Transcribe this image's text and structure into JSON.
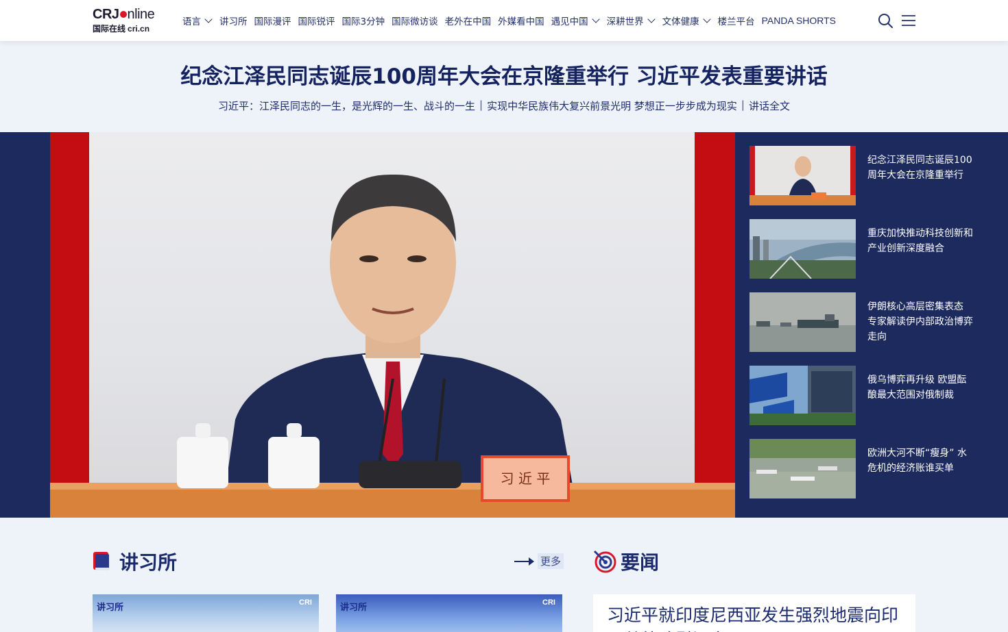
{
  "header": {
    "logo_brand": "CRJ",
    "logo_online": "nline",
    "logo_chinese": "国际在线",
    "logo_domain": "cri.cn",
    "nav": [
      {
        "label": "语言",
        "dropdown": true
      },
      {
        "label": "讲习所",
        "dropdown": false
      },
      {
        "label": "国际漫评",
        "dropdown": false
      },
      {
        "label": "国际锐评",
        "dropdown": false
      },
      {
        "label": "国际3分钟",
        "dropdown": false
      },
      {
        "label": "国际微访谈",
        "dropdown": false
      },
      {
        "label": "老外在中国",
        "dropdown": false
      },
      {
        "label": "外媒看中国",
        "dropdown": false
      },
      {
        "label": "遇见中国",
        "dropdown": true
      },
      {
        "label": "深耕世界",
        "dropdown": true
      },
      {
        "label": "文体健康",
        "dropdown": true
      },
      {
        "label": "楼兰平台",
        "dropdown": false
      },
      {
        "label": "PANDA SHORTS",
        "dropdown": false
      }
    ],
    "icons": {
      "search": "search-icon",
      "menu": "menu-icon"
    }
  },
  "headline": {
    "title": "纪念江泽民同志诞辰100周年大会在京隆重举行 习近平发表重要讲话",
    "links": [
      "习近平：江泽民同志的一生，是光辉的一生、战斗的一生",
      "实现中华民族伟大复兴前景光明 梦想正一步步成为现实",
      "讲话全文"
    ],
    "separator": "|"
  },
  "hero": {
    "nameplate": "习 近 平"
  },
  "side_news": [
    {
      "title": "纪念江泽民同志诞辰100周年大会在京隆重举行",
      "thumb": "conference"
    },
    {
      "title": "重庆加快推动科技创新和产业创新深度融合",
      "thumb": "city"
    },
    {
      "title": "伊朗核心高层密集表态 专家解读伊内部政治博弈走向",
      "thumb": "ships"
    },
    {
      "title": "俄乌博弈再升级 欧盟酝酿最大范围对俄制裁",
      "thumb": "eu-flags"
    },
    {
      "title": "欧洲大河不断“瘦身” 水危机的经济账谁买单",
      "thumb": "river"
    }
  ],
  "sections": {
    "jiangxisuo": {
      "title": "讲习所",
      "more": "更多",
      "card_brand": "讲习所",
      "card_brand_accent": "习"
    },
    "yaowen": {
      "title": "要闻",
      "first_headline": "习近平就印度尼西亚发生强烈地震向印尼总统致慰问电"
    }
  },
  "colors": {
    "navy": "#1c2a5e",
    "title_blue": "#14225f",
    "accent_red": "#d6182a",
    "background": "#eef2f9"
  }
}
